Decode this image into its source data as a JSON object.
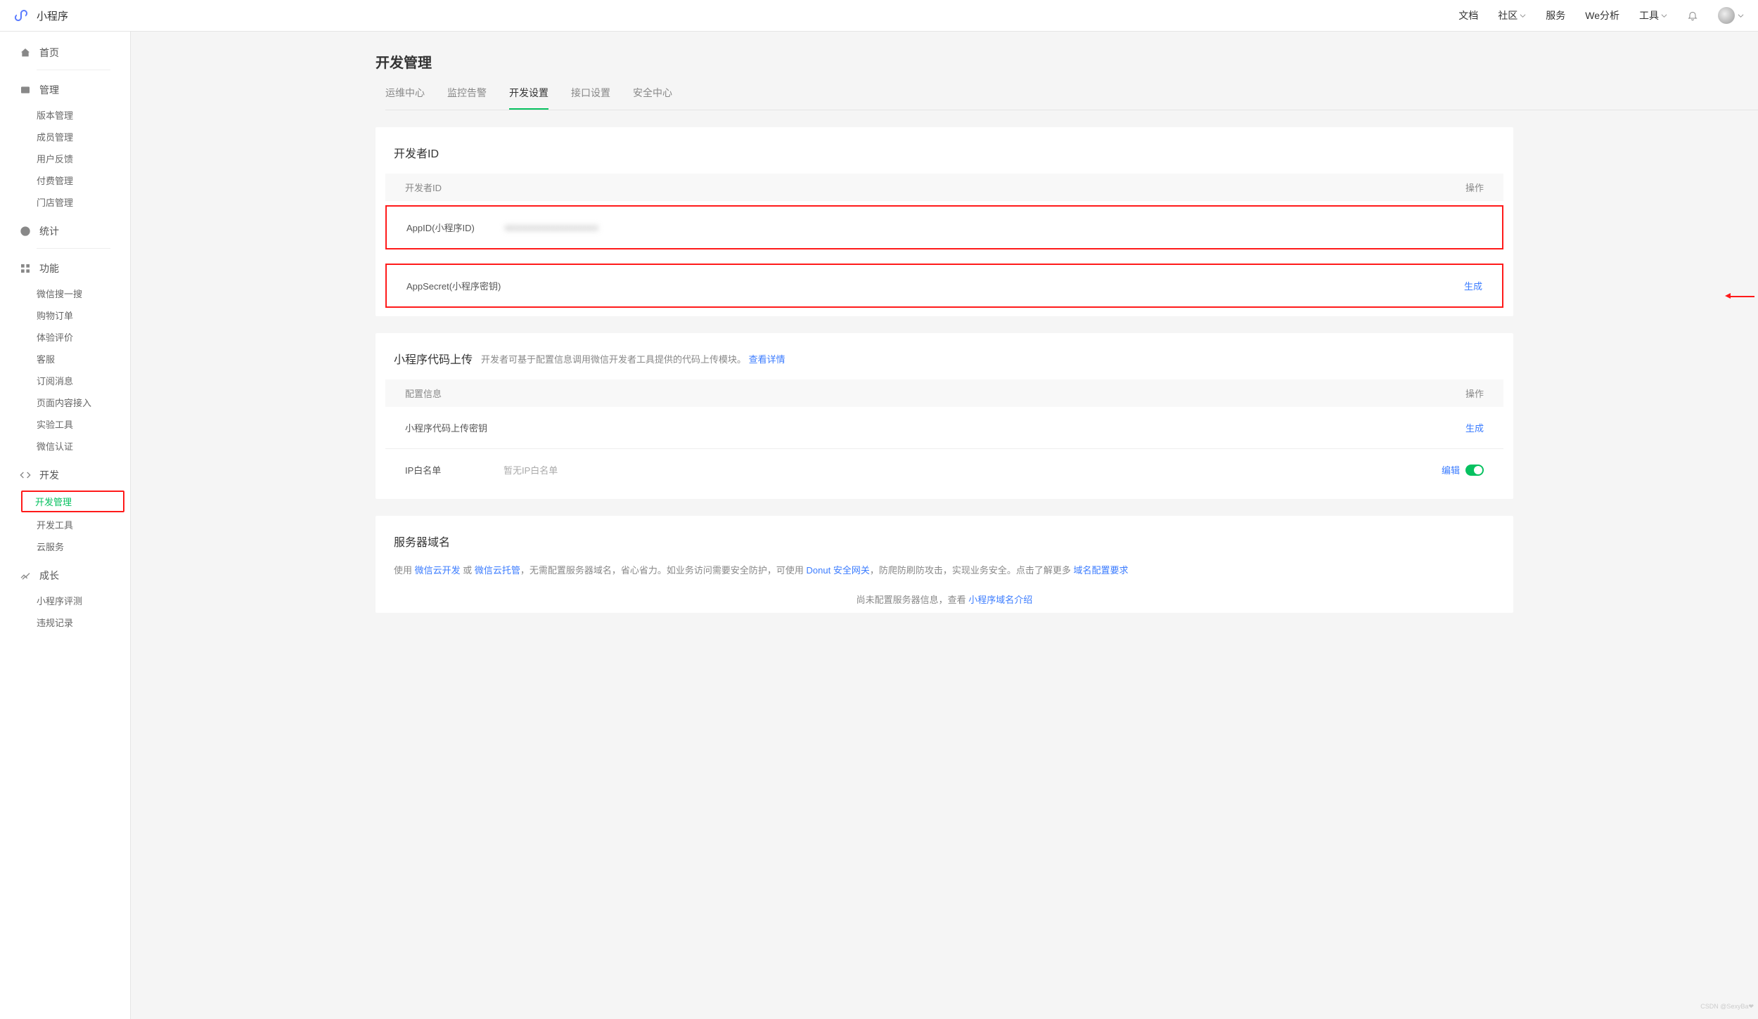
{
  "header": {
    "logo_text": "小程序",
    "nav": [
      "文档",
      "社区",
      "服务",
      "We分析",
      "工具"
    ]
  },
  "sidebar": {
    "sections": [
      {
        "label": "首页",
        "icon": "home",
        "items": []
      },
      {
        "label": "管理",
        "icon": "manage",
        "items": [
          "版本管理",
          "成员管理",
          "用户反馈",
          "付费管理",
          "门店管理"
        ]
      },
      {
        "label": "统计",
        "icon": "stats",
        "items": []
      },
      {
        "label": "功能",
        "icon": "func",
        "items": [
          "微信搜一搜",
          "购物订单",
          "体验评价",
          "客服",
          "订阅消息",
          "页面内容接入",
          "实验工具",
          "微信认证"
        ]
      },
      {
        "label": "开发",
        "icon": "dev",
        "items": [
          "开发管理",
          "开发工具",
          "云服务"
        ],
        "active": 0
      },
      {
        "label": "成长",
        "icon": "growth",
        "items": [
          "小程序评测",
          "违规记录"
        ]
      }
    ]
  },
  "page": {
    "title": "开发管理",
    "tabs": [
      "运维中心",
      "监控告警",
      "开发设置",
      "接口设置",
      "安全中心"
    ],
    "active_tab": 2
  },
  "dev_id": {
    "title": "开发者ID",
    "col_left": "开发者ID",
    "col_right": "操作",
    "appid_label": "AppID(小程序ID)",
    "appid_value": "wxxxxxxxxxxxxxxxxxxx",
    "secret_label": "AppSecret(小程序密钥)",
    "secret_action": "生成"
  },
  "code_upload": {
    "title": "小程序代码上传",
    "subtitle": "开发者可基于配置信息调用微信开发者工具提供的代码上传模块。",
    "view_detail": "查看详情",
    "col_left": "配置信息",
    "col_right": "操作",
    "key_label": "小程序代码上传密钥",
    "key_action": "生成",
    "whitelist_label": "IP白名单",
    "whitelist_value": "暂无IP白名单",
    "whitelist_action": "编辑"
  },
  "server": {
    "title": "服务器域名",
    "desc_pre": "使用 ",
    "link1": "微信云开发",
    "or": " 或 ",
    "link2": "微信云托管",
    "desc_mid": "，无需配置服务器域名，省心省力。如业务访问需要安全防护，可使用 ",
    "link3": "Donut 安全网关",
    "desc_post": "，防爬防刷防攻击，实现业务安全。点击了解更多 ",
    "link4": "域名配置要求",
    "bottom_text": "尚未配置服务器信息，查看 ",
    "bottom_link": "小程序域名介绍"
  },
  "watermark": "CSDN @SexyBa❤"
}
